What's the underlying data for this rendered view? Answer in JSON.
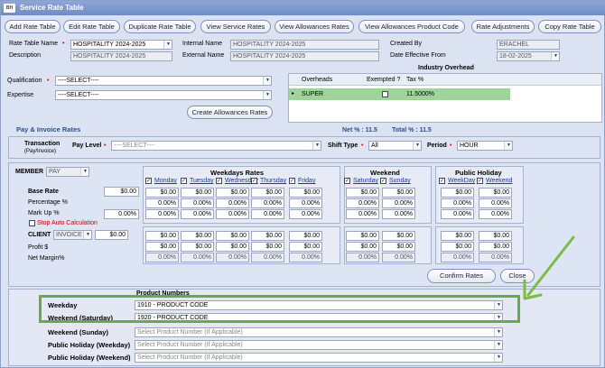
{
  "window": {
    "title": "Service Rate Table",
    "icon": "BH"
  },
  "toolbar": [
    "Add Rate Table",
    "Edit Rate Table",
    "Duplicate Rate Table",
    "View Service Rates",
    "View Allowances Rates",
    "View Allowances Product Code",
    "Rate Adjustments",
    "Copy Rate Table"
  ],
  "header": {
    "rate_table_name_label": "Rate Table Name",
    "rate_table_name": "HOSPITALITY 2024-2025",
    "description_label": "Description",
    "description": "HOSPITALITY 2024-2025",
    "internal_name_label": "Internal Name",
    "internal_name": "HOSPITALITY 2024-2025",
    "external_name_label": "External Name",
    "external_name": "HOSPITALITY 2024-2025",
    "created_by_label": "Created By",
    "created_by": "ERACHEL",
    "date_effective_label": "Date Effective From",
    "date_effective": "18-02-2025"
  },
  "qualification": {
    "label": "Qualification",
    "value": "----SELECT----"
  },
  "expertise": {
    "label": "Expertise",
    "value": "----SELECT----"
  },
  "create_allowances_label": "Create Allowances Rates",
  "industry_overhead": {
    "title": "Industry Overhead",
    "columns": [
      "Overheads",
      "Exempted ?",
      "Tax %"
    ],
    "row": {
      "marker": "▸",
      "overhead": "SUPER",
      "tax": "11.5000%"
    }
  },
  "pay_invoice": {
    "title": "Pay & Invoice Rates",
    "net": "Net % : 11.5",
    "total": "Total % : 11.5"
  },
  "filters": {
    "transaction_label": "Transaction",
    "transaction_sub": "(Pay/Invoice)",
    "pay_level_label": "Pay Level",
    "pay_level": "----SELECT----",
    "shift_type_label": "Shift Type",
    "shift_type": "All",
    "period_label": "Period",
    "period": "HOUR"
  },
  "member": {
    "label": "MEMBER",
    "pay": "PAY"
  },
  "rates": {
    "base_rate_label": "Base Rate",
    "base_rate": "$0.00",
    "percentage_label": "Percentage %",
    "markup_label": "Mark Up %",
    "markup": "0.00%",
    "stop_auto": "Stop Auto Calculation",
    "client_label": "CLIENT",
    "client_type": "INVOICE",
    "client_value": "$0.00",
    "profit_label": "Profit $",
    "net_margin_label": "Net Margin%"
  },
  "weekdays": {
    "title": "Weekdays Rates",
    "days": [
      "Monday",
      "Tuesday",
      "Wednesday",
      "Thursday",
      "Friday"
    ]
  },
  "weekend": {
    "title": "Weekend",
    "days": [
      "Saturday",
      "Sunday"
    ]
  },
  "public_holiday": {
    "title": "Public Holiday",
    "days": [
      "WeekDay",
      "Weekend"
    ]
  },
  "cell": {
    "dollar": "$0.00",
    "pct": "0.00%",
    "check": "✓"
  },
  "actions": {
    "confirm": "Confirm Rates",
    "close": "Close"
  },
  "product_numbers": {
    "title": "Product Numbers",
    "placeholder": "Select Product Number (If Applicable)",
    "rows": [
      {
        "label": "Weekday",
        "value": "1910 - PRODUCT CODE"
      },
      {
        "label": "Weekend (Saturday)",
        "value": "1920 - PRODUCT CODE"
      },
      {
        "label": "Weekend (Sunday)",
        "value": ""
      },
      {
        "label": "Public Holiday (Weekday)",
        "value": ""
      },
      {
        "label": "Public Holiday (Weekend)",
        "value": ""
      }
    ]
  },
  "colors": {
    "highlight_green": "#6aa84f",
    "arrow_green": "#7dba47",
    "row_green": "#9ed39a"
  }
}
